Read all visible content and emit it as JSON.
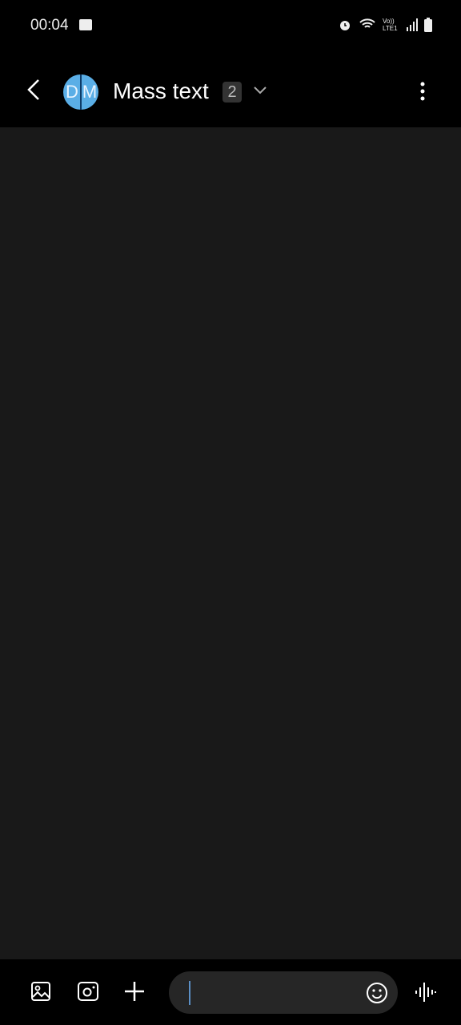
{
  "status": {
    "time": "00:04",
    "network": "Vo)) LTE1"
  },
  "header": {
    "avatar_initials": [
      "D",
      "M"
    ],
    "title": "Mass text",
    "count": "2"
  },
  "composer": {
    "value": "",
    "placeholder": ""
  },
  "colors": {
    "avatar": "#5aaee6",
    "background": "#191919",
    "caret": "#5b8fc4"
  }
}
